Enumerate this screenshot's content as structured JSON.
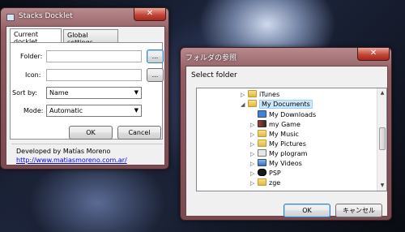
{
  "stacks": {
    "title": "Stacks Docklet",
    "close": "✕",
    "tabs": [
      "Current docklet",
      "Global settings"
    ],
    "folder_label": "Folder:",
    "folder_value": "",
    "icon_label": "Icon:",
    "icon_value": "",
    "browse": "...",
    "sort_label": "Sort by:",
    "sort_value": "Name",
    "mode_label": "Mode:",
    "mode_value": "Automatic",
    "ok": "OK",
    "cancel": "Cancel",
    "footer": "Developed by Matías Moreno",
    "link": "http://www.matiasmoreno.com.ar/"
  },
  "browse_dialog": {
    "title": "フォルダの参照",
    "close": "✕",
    "prompt": "Select folder",
    "tree": [
      {
        "label": "iTunes",
        "expander": "▷",
        "icon": "folder"
      },
      {
        "label": "My Documents",
        "expander": "◢",
        "icon": "folder",
        "selected": true
      },
      {
        "label": "My Downloads",
        "expander": "",
        "icon": "downloads"
      },
      {
        "label": "my Game",
        "expander": "▷",
        "icon": "game"
      },
      {
        "label": "My Music",
        "expander": "▷",
        "icon": "music"
      },
      {
        "label": "My Pictures",
        "expander": "▷",
        "icon": "pictures"
      },
      {
        "label": "My plogram",
        "expander": "▷",
        "icon": "program"
      },
      {
        "label": "My Videos",
        "expander": "▷",
        "icon": "videos"
      },
      {
        "label": "PSP",
        "expander": "▷",
        "icon": "psp"
      },
      {
        "label": "zge",
        "expander": "▷",
        "icon": "folder"
      }
    ],
    "ok": "OK",
    "cancel": "キャンセル"
  }
}
